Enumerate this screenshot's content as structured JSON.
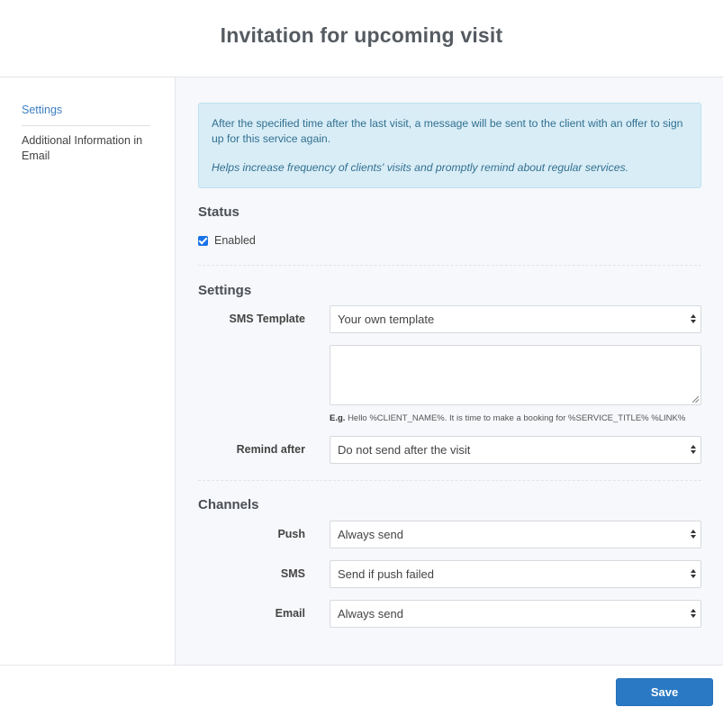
{
  "header": {
    "title": "Invitation for upcoming visit"
  },
  "sidebar": {
    "items": [
      {
        "label": "Settings",
        "active": true
      },
      {
        "label": "Additional Information in Email",
        "active": false
      }
    ]
  },
  "info": {
    "text": "After the specified time after the last visit, a message will be sent to the client with an offer to sign up for this service again.",
    "note": "Helps increase frequency of clients' visits and promptly remind about regular services."
  },
  "status": {
    "title": "Status",
    "enabled_label": "Enabled",
    "enabled": true
  },
  "settings": {
    "title": "Settings",
    "sms_template_label": "SMS Template",
    "sms_template_value": "Your own template",
    "template_text": "",
    "hint_prefix": "E.g.",
    "hint_text": "Hello %CLIENT_NAME%. It is time to make a booking for %SERVICE_TITLE% %LINK%",
    "remind_label": "Remind after",
    "remind_value": "Do not send after the visit"
  },
  "channels": {
    "title": "Channels",
    "push_label": "Push",
    "push_value": "Always send",
    "sms_label": "SMS",
    "sms_value": "Send if push failed",
    "email_label": "Email",
    "email_value": "Always send"
  },
  "footer": {
    "save_label": "Save"
  },
  "colors": {
    "accent": "#2a79c4",
    "info_bg": "#d9edf7",
    "info_text": "#31708f",
    "checkbox": "#1a73e8"
  },
  "icons": {
    "checkbox": "checkbox-checked-icon",
    "select_arrows": "select-updown-icon",
    "resize": "resize-grip-icon"
  }
}
